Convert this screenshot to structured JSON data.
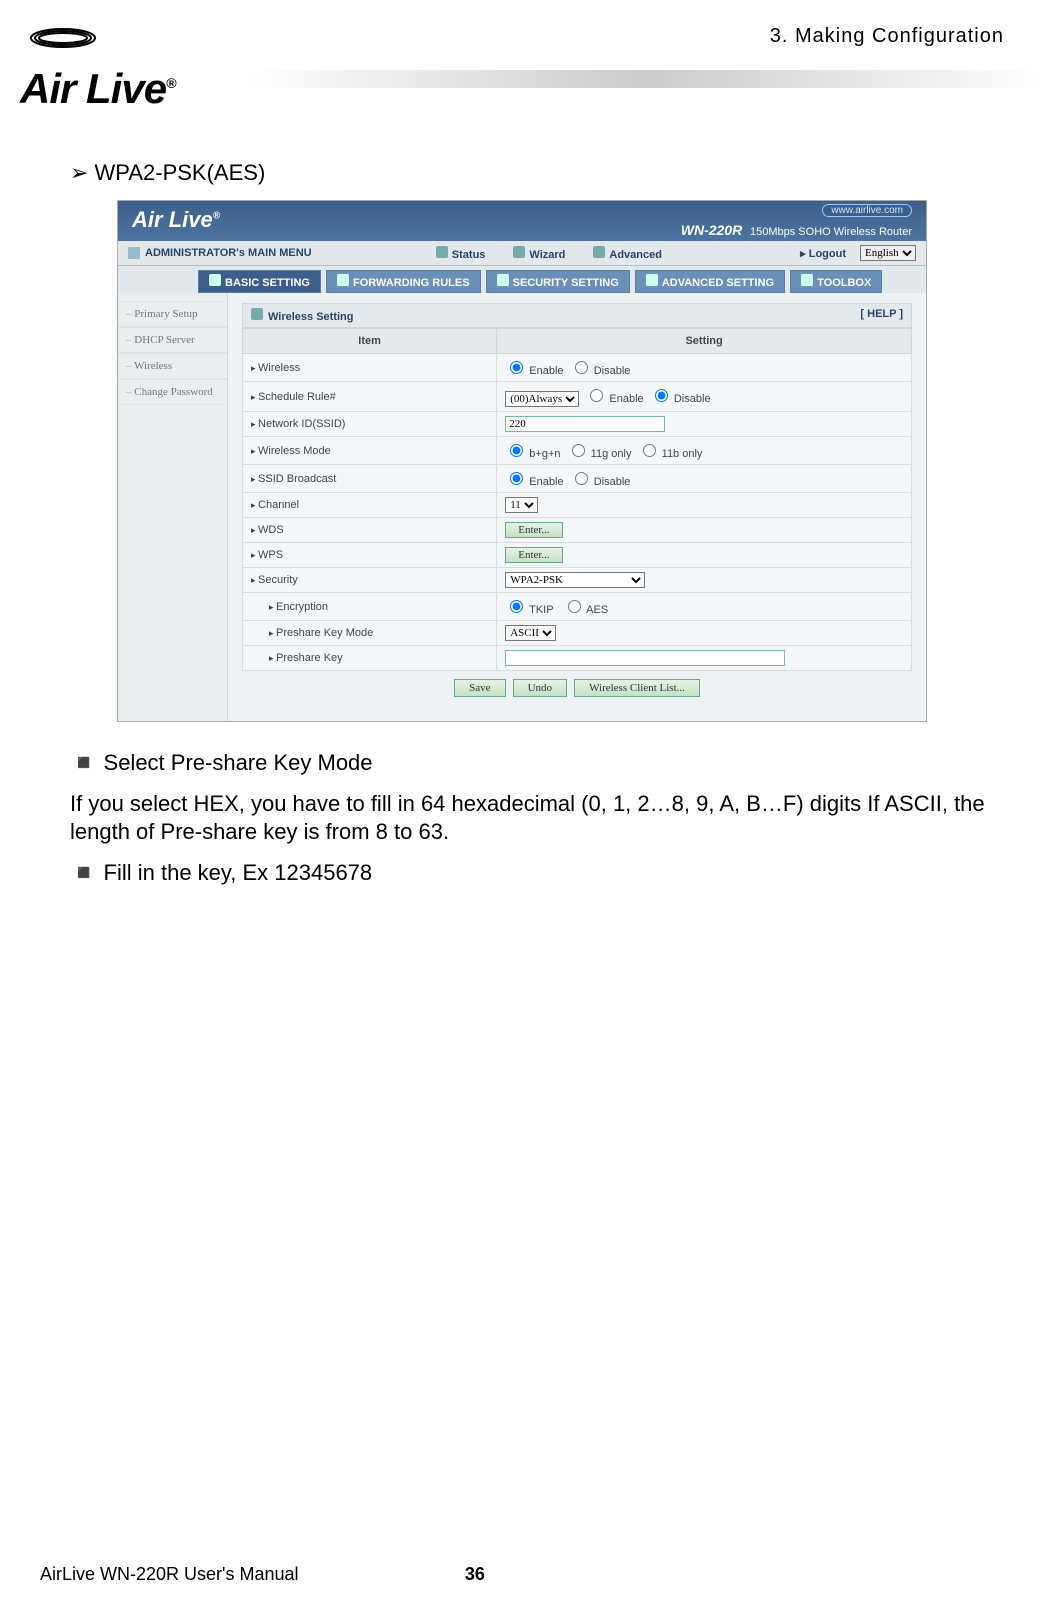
{
  "page": {
    "header_right": "3. Making Configuration",
    "logo_text": "Air Live",
    "reg": "®",
    "footer_left": "AirLive WN-220R User's Manual",
    "footer_page": "36"
  },
  "doc": {
    "bullet_cfg_title": "WPA2-PSK(AES)",
    "b_select": "Select Pre-share Key Mode",
    "body_hex": "If you select HEX, you have to fill in 64 hexadecimal (0, 1, 2…8, 9, A, B…F) digits If ASCII, the length of Pre-share key is from 8 to 63.",
    "b_fill": "Fill in the key, Ex 12345678"
  },
  "shot": {
    "logo": "Air Live",
    "url": "www.airlive.com",
    "model": "WN-220R",
    "model_sub": "150Mbps SOHO Wireless Router",
    "menu": {
      "title": "ADMINISTRATOR's MAIN MENU",
      "status": "Status",
      "wizard": "Wizard",
      "advanced": "Advanced",
      "logout": "▸ Logout",
      "lang": "English"
    },
    "tabs": {
      "basic": "BASIC SETTING",
      "forward": "FORWARDING RULES",
      "security": "SECURITY SETTING",
      "adv": "ADVANCED SETTING",
      "tool": "TOOLBOX"
    },
    "side": {
      "primary": "Primary Setup",
      "dhcp": "DHCP Server",
      "wireless": "Wireless",
      "chpass": "Change Password"
    },
    "panel_title": "Wireless Setting",
    "help": "[ HELP ]",
    "th_item": "Item",
    "th_setting": "Setting",
    "rows": {
      "wireless": "Wireless",
      "sched": "Schedule Rule#",
      "ssid": "Network ID(SSID)",
      "mode": "Wireless Mode",
      "bcast": "SSID Broadcast",
      "channel": "Channel",
      "wds": "WDS",
      "wps": "WPS",
      "sec": "Security",
      "enc": "Encryption",
      "pkm": "Preshare Key Mode",
      "pk": "Preshare Key"
    },
    "vals": {
      "enable": "Enable",
      "disable": "Disable",
      "sched_opt": "(00)Always",
      "ssid_val": "220",
      "mode_a": "b+g+n",
      "mode_b": "11g only",
      "mode_c": "11b only",
      "chan": "11",
      "enter": "Enter...",
      "sec_opt": "WPA2-PSK",
      "enc_a": "TKIP",
      "enc_b": "AES",
      "pkm_opt": "ASCII"
    },
    "btns": {
      "save": "Save",
      "undo": "Undo",
      "wcl": "Wireless Client List..."
    }
  }
}
